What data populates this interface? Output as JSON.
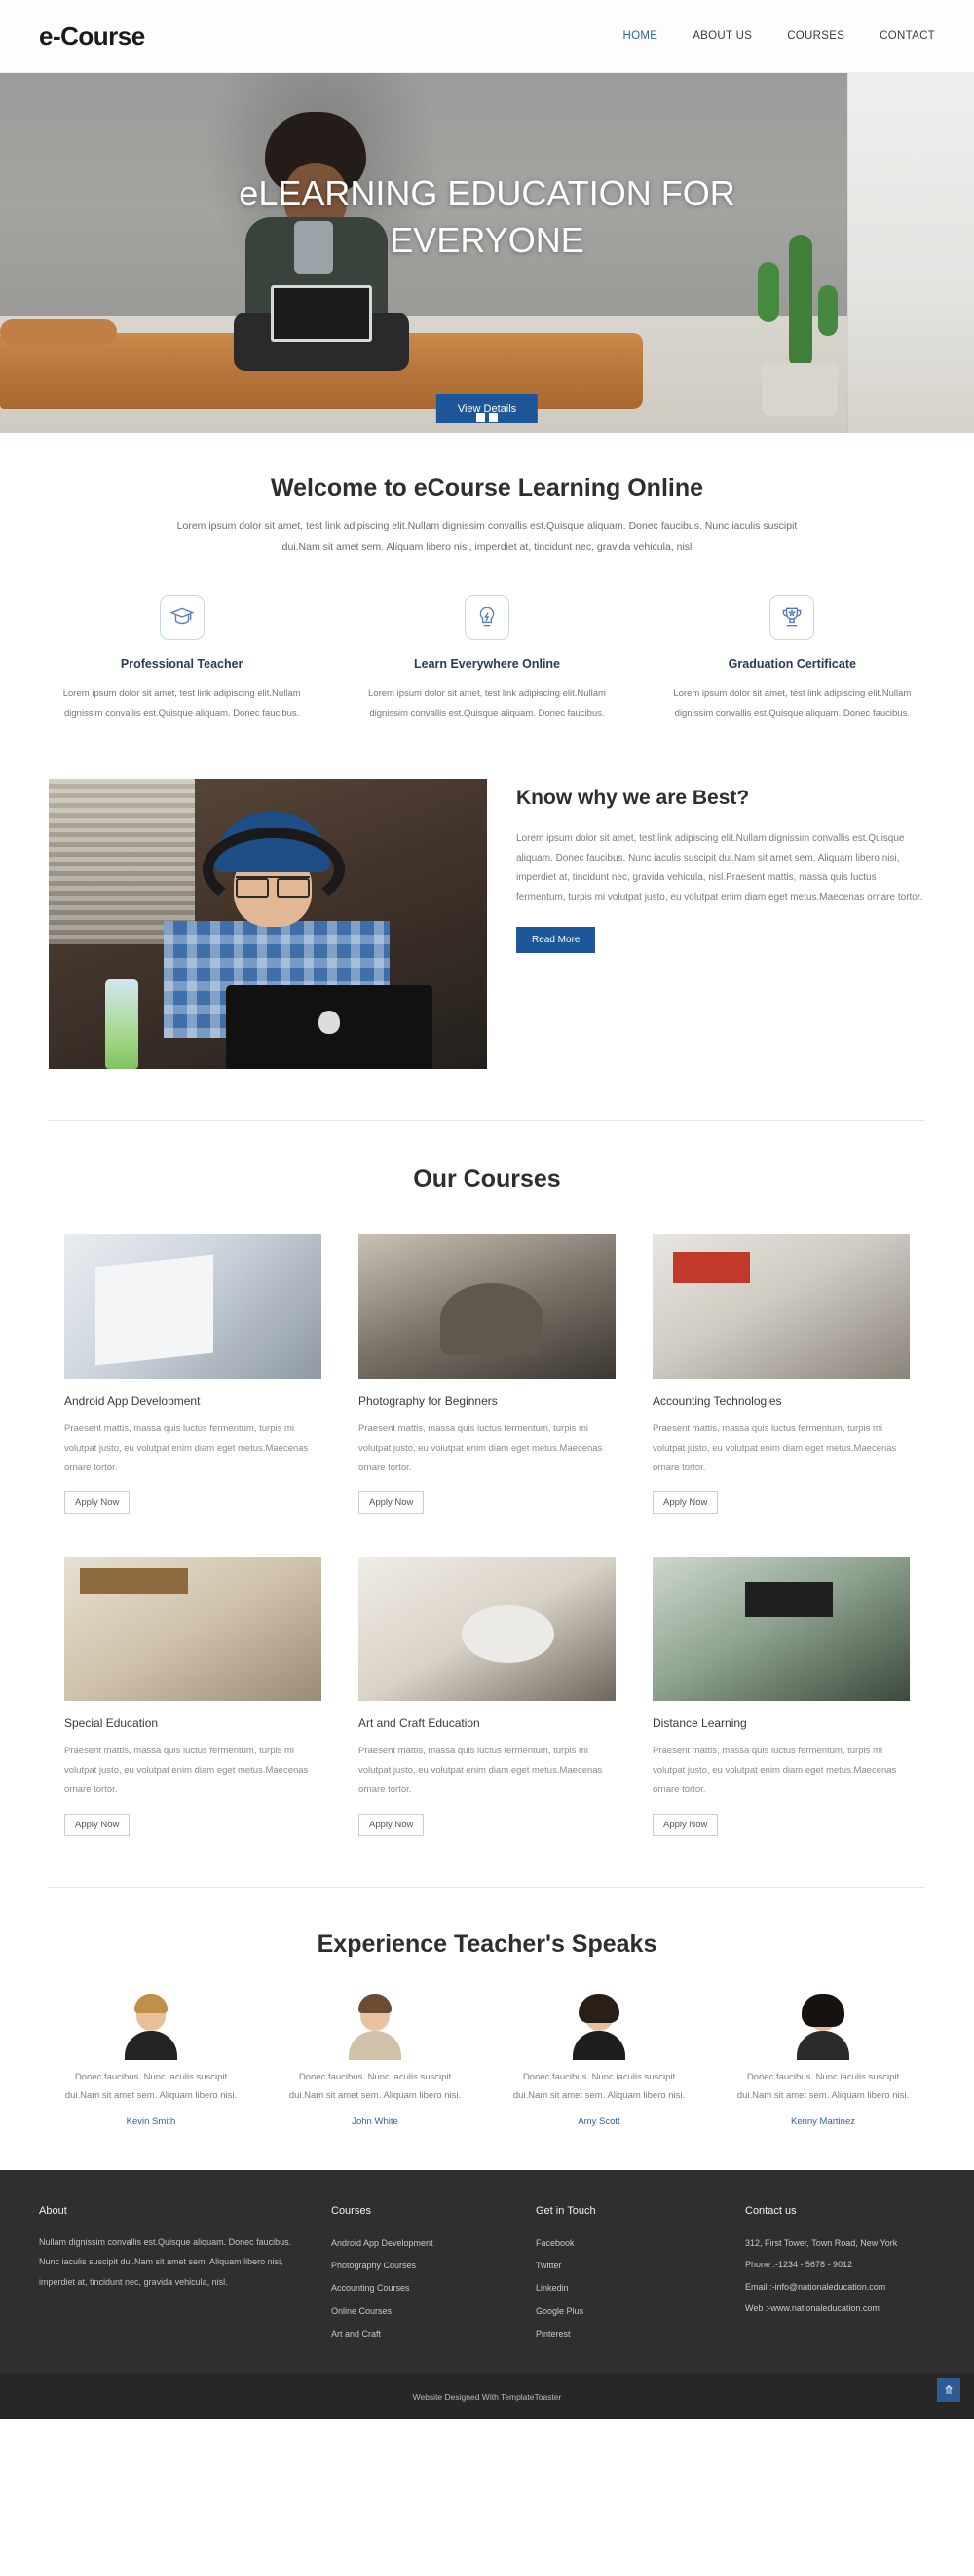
{
  "header": {
    "logo": "e-Course",
    "nav": [
      {
        "label": "HOME",
        "active": true
      },
      {
        "label": "ABOUT US",
        "active": false
      },
      {
        "label": "COURSES",
        "active": false
      },
      {
        "label": "CONTACT",
        "active": false
      }
    ]
  },
  "hero": {
    "title": "eLEARNING EDUCATION FOR EVERYONE",
    "button": "View Details",
    "slides": 2,
    "active_slide": 1
  },
  "welcome": {
    "title": "Welcome to eCourse Learning Online",
    "paragraph": "Lorem ipsum dolor sit amet, test link adipiscing elit.Nullam dignissim convallis est.Quisque aliquam. Donec faucibus. Nunc iaculis suscipit dui.Nam sit amet sem. Aliquam libero nisi, imperdiet at, tincidunt nec, gravida vehicula, nisl"
  },
  "features": [
    {
      "icon": "graduation-cap-icon",
      "title": "Professional Teacher",
      "text": "Lorem ipsum dolor sit amet, test link adipiscing elit.Nullam dignissim convallis est.Quisque aliquam. Donec faucibus."
    },
    {
      "icon": "lightbulb-icon",
      "title": "Learn Everywhere Online",
      "text": "Lorem ipsum dolor sit amet, test link adipiscing elit.Nullam dignissim convallis est.Quisque aliquam. Donec faucibus."
    },
    {
      "icon": "trophy-icon",
      "title": "Graduation Certificate",
      "text": "Lorem ipsum dolor sit amet, test link adipiscing elit.Nullam dignissim convallis est.Quisque aliquam. Donec faucibus."
    }
  ],
  "know_why": {
    "title": "Know why we are Best?",
    "text": "Lorem ipsum dolor sit amet, test link adipiscing elit.Nullam dignissim convallis est.Quisque aliquam. Donec faucibus. Nunc iaculis suscipit dui.Nam sit amet sem. Aliquam libero nisi, imperdiet at, tincidunt nec, gravida vehicula, nisl.Praesent mattis, massa quis luctus fermentum, turpis mi volutpat justo, eu volutpat enim diam eget metus.Maecenas ornare tortor.",
    "button": "Read More"
  },
  "courses": {
    "title": "Our Courses",
    "apply_label": "Apply Now",
    "description": "Praesent mattis, massa quis luctus fermentum, turpis mi volutpat justo, eu volutpat enim diam eget metus.Maecenas ornare tortor.",
    "items": [
      {
        "title": "Android App Development"
      },
      {
        "title": "Photography for Beginners"
      },
      {
        "title": "Accounting Technologies"
      },
      {
        "title": "Special Education"
      },
      {
        "title": "Art and Craft Education"
      },
      {
        "title": "Distance Learning"
      }
    ]
  },
  "testimonials": {
    "title": "Experience Teacher's Speaks",
    "items": [
      {
        "quote": "Donec faucibus. Nunc iaculis suscipit dui.Nam sit amet sem. Aliquam libero nisi.",
        "name": "Kevin Smith"
      },
      {
        "quote": "Donec faucibus. Nunc iaculis suscipit dui.Nam sit amet sem. Aliquam libero nisi.",
        "name": "John White"
      },
      {
        "quote": "Donec faucibus. Nunc iaculis suscipit dui.Nam sit amet sem. Aliquam libero nisi.",
        "name": "Amy Scott"
      },
      {
        "quote": "Donec faucibus. Nunc iaculis suscipit dui.Nam sit amet sem. Aliquam libero nisi.",
        "name": "Kenny Martinez"
      }
    ]
  },
  "footer": {
    "about": {
      "title": "About",
      "text": "Nullam dignissim convallis est.Quisque aliquam. Donec faucibus. Nunc iaculis suscipit dui.Nam sit amet sem. Aliquam libero nisi, imperdiet at, tincidunt nec, gravida vehicula, nisl."
    },
    "courses": {
      "title": "Courses",
      "items": [
        "Android App Development",
        "Photography Courses",
        "Accounting Courses",
        "Online Courses",
        "Art and Craft"
      ]
    },
    "get_in_touch": {
      "title": "Get in Touch",
      "items": [
        "Facebook",
        "Twitter",
        "Linkedin",
        "Google Plus",
        "Pinterest"
      ]
    },
    "contact": {
      "title": "Contact us",
      "address": "312, First Tower, Town Road, New York",
      "phone": "Phone :-1234 - 5678 - 9012",
      "email": "Email :-info@nationaleducation.com",
      "web": "Web :-www.nationaleducation.com"
    },
    "credit": "Website Designed With TemplateToaster",
    "to_top_icon": "chevron-up-icon"
  },
  "colors": {
    "primary_blue": "#1e5799",
    "link_blue": "#2f5fa8",
    "footer_bg": "#2f2f2f",
    "footer_bottom_bg": "#272727",
    "heading": "#2e2e2e"
  }
}
